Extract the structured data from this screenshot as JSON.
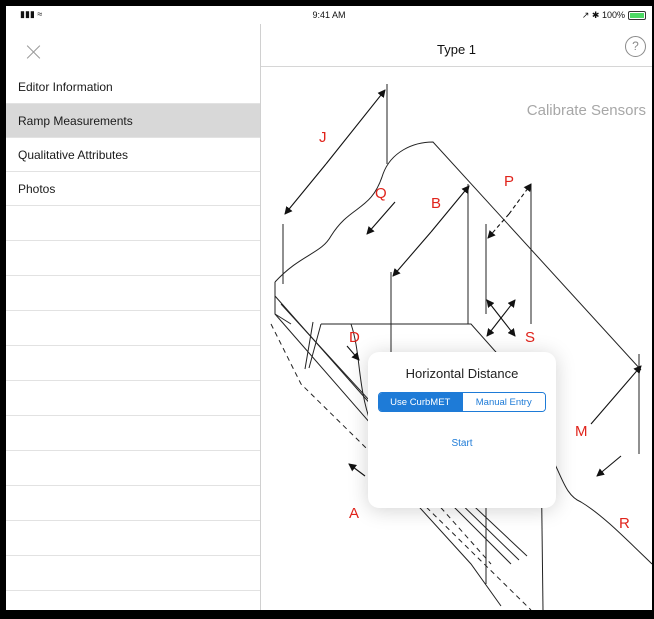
{
  "status_bar": {
    "time": "9:41 AM",
    "signal": "… 📶",
    "battery_text": "↗ ✱ 100%",
    "battery_level": 1.0
  },
  "sidebar": {
    "close_icon": "close-icon",
    "items": [
      {
        "label": "Editor Information",
        "selected": false
      },
      {
        "label": "Ramp Measurements",
        "selected": true
      },
      {
        "label": "Qualitative Attributes",
        "selected": false
      },
      {
        "label": "Photos",
        "selected": false
      }
    ]
  },
  "header": {
    "title": "Type 1",
    "help_label": "?"
  },
  "main": {
    "calibrate_label": "Calibrate Sensors",
    "diagram_labels": {
      "J": "J",
      "Q": "Q",
      "B": "B",
      "P": "P",
      "D": "D",
      "S": "S",
      "M": "M",
      "A": "A",
      "R": "R"
    }
  },
  "modal": {
    "title": "Horizontal Distance",
    "segments": [
      "Use CurbMET",
      "Manual Entry"
    ],
    "selected_segment": "Use CurbMET",
    "start_label": "Start"
  },
  "colors": {
    "accent": "#1e7bd7",
    "label_red": "#e0231b",
    "selected_row": "#d8d8d8"
  }
}
